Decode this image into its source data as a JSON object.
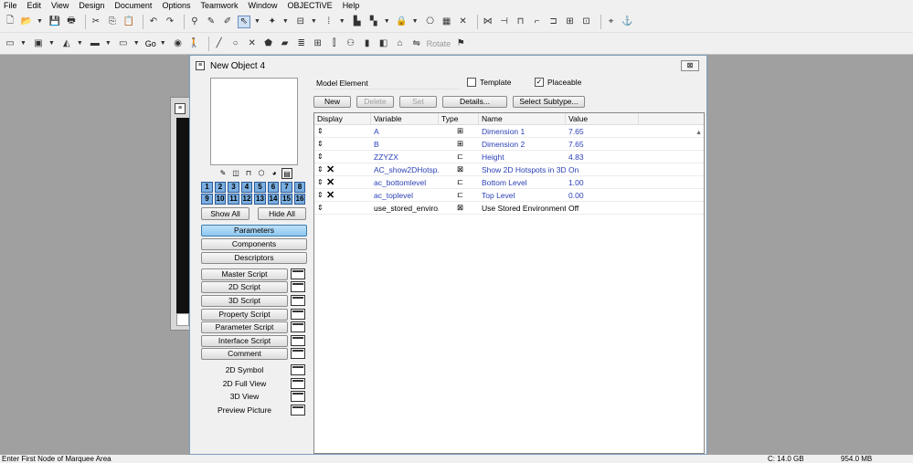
{
  "menu": [
    "File",
    "Edit",
    "View",
    "Design",
    "Document",
    "Options",
    "Teamwork",
    "Window",
    "OBJECTiVE",
    "Help"
  ],
  "toolbar": {
    "go_label": "Go",
    "rotate_label": "Rotate"
  },
  "window": {
    "title": "New Object 4",
    "close_label": "⊠"
  },
  "numbers_row1": [
    "1",
    "2",
    "3",
    "4",
    "5",
    "6",
    "7",
    "8"
  ],
  "numbers_row2": [
    "9",
    "10",
    "11",
    "12",
    "13",
    "14",
    "15",
    "16"
  ],
  "side": {
    "show_all": "Show All",
    "hide_all": "Hide All",
    "parameters": "Parameters",
    "components": "Components",
    "descriptors": "Descriptors",
    "master_script": "Master Script",
    "script_2d": "2D Script",
    "script_3d": "3D Script",
    "property_script": "Property Script",
    "parameter_script": "Parameter Script",
    "interface_script": "Interface Script",
    "comment": "Comment",
    "symbol_2d": "2D Symbol",
    "full_view_2d": "2D Full View",
    "view_3d": "3D View",
    "preview_picture": "Preview Picture"
  },
  "main": {
    "model_element": "Model Element",
    "template_label": "Template",
    "template_checked": false,
    "placeable_label": "Placeable",
    "placeable_checked": true,
    "new_btn": "New",
    "delete_btn": "Delete",
    "set_btn": "Set",
    "details_btn": "Details...",
    "subtype_btn": "Select Subtype..."
  },
  "grid_headers": [
    "Display",
    "Variable",
    "Type",
    "Name",
    "Value"
  ],
  "grid_rows": [
    {
      "x": false,
      "variable": "A",
      "type": "dim-icon",
      "name": "Dimension 1",
      "value": "7.65",
      "blue": true
    },
    {
      "x": false,
      "variable": "B",
      "type": "dim-icon",
      "name": "Dimension 2",
      "value": "7.65",
      "blue": true
    },
    {
      "x": false,
      "variable": "ZZYZX",
      "type": "length-icon",
      "name": "Height",
      "value": "4.83",
      "blue": true
    },
    {
      "x": true,
      "variable": "AC_show2DHotsp...",
      "type": "boolean-icon",
      "name": "Show 2D Hotspots in 3D",
      "value": "On",
      "blue": true
    },
    {
      "x": true,
      "variable": "ac_bottomlevel",
      "type": "length-icon",
      "name": "Bottom Level",
      "value": "1.00",
      "blue": true
    },
    {
      "x": true,
      "variable": "ac_toplevel",
      "type": "length-icon",
      "name": "Top Level",
      "value": "0.00",
      "blue": true
    },
    {
      "x": false,
      "variable": "use_stored_enviro...",
      "type": "boolean-icon",
      "name": "Use Stored Environment",
      "value": "Off",
      "blue": false
    }
  ],
  "status": {
    "left": "Enter First Node of Marquee Area",
    "disk": "C: 14.0 GB",
    "mem": "954.0 MB"
  },
  "colors": {
    "accent": "#2a3fb5",
    "active_tab": "#8ec7ef",
    "number_btn": "#7aaee0"
  }
}
